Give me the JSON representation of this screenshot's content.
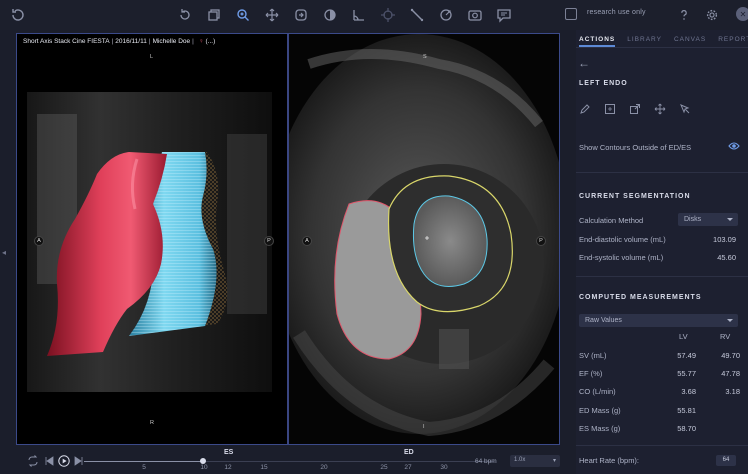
{
  "toolbar": {
    "left_icon": "refresh-icon",
    "icons": [
      "rotate-icon",
      "copy-icon",
      "zoom-icon",
      "pan-icon",
      "sync-icon",
      "contrast-icon",
      "angle-icon",
      "crosshair-icon",
      "ruler-icon",
      "roi-icon",
      "snapshot-icon",
      "annotation-icon"
    ],
    "research_label": "research use only",
    "help_icon": "help-icon",
    "settings_icon": "gear-icon",
    "close_icon": "close-icon"
  },
  "viewer": {
    "series": "Short Axis Stack Cine FIESTA",
    "date": "2016/11/11",
    "patient": "Michelle Doe",
    "sex_symbol": "♀",
    "extra": "(...)",
    "left": {
      "top": "L",
      "left": "A",
      "right": "P",
      "bottom": "R"
    },
    "right": {
      "top": "S",
      "left": "A",
      "right": "P",
      "bottom": "I"
    }
  },
  "timeline": {
    "es_label": "ES",
    "ed_label": "ED",
    "ticks": [
      "5",
      "10",
      "12",
      "15",
      "20",
      "25",
      "27",
      "30"
    ],
    "bpm": "64 bpm",
    "speed": "1.0x",
    "progress": 0.29
  },
  "panel": {
    "tabs": [
      "ACTIONS",
      "LIBRARY",
      "CANVAS",
      "REPORT"
    ],
    "active_tab": "ACTIONS",
    "contour_title": "LEFT ENDO",
    "tool_icons": [
      "brush-icon",
      "grid-icon",
      "scale-icon",
      "move-icon",
      "cursor-icon"
    ],
    "show_contours_label": "Show Contours Outside of ED/ES",
    "segmentation": {
      "title": "CURRENT SEGMENTATION",
      "method_label": "Calculation Method",
      "method_value": "Disks",
      "edv_label": "End-diastolic volume (mL)",
      "edv_value": "103.09",
      "esv_label": "End-systolic volume (mL)",
      "esv_value": "45.60"
    },
    "measurements": {
      "title": "COMPUTED MEASUREMENTS",
      "dropdown": "Raw Values",
      "col_lv": "LV",
      "col_rv": "RV",
      "rows": [
        {
          "label": "SV (mL)",
          "lv": "57.49",
          "rv": "49.70"
        },
        {
          "label": "EF (%)",
          "lv": "55.77",
          "rv": "47.78"
        },
        {
          "label": "CO (L/min)",
          "lv": "3.68",
          "rv": "3.18"
        },
        {
          "label": "ED Mass (g)",
          "lv": "55.81",
          "rv": ""
        },
        {
          "label": "ES Mass (g)",
          "lv": "58.70",
          "rv": ""
        }
      ],
      "hr_label": "Heart Rate (bpm):",
      "hr_value": "64"
    }
  },
  "colors": {
    "accent": "#5d8ad6",
    "frame": "#3b4a8a",
    "rv_red": "#d8384f",
    "lv_blue": "#5cc8e6",
    "epi_yellow": "#d9d66a"
  }
}
